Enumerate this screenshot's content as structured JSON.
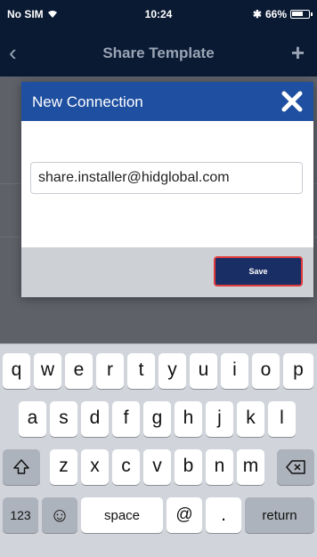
{
  "status_bar": {
    "carrier": "No SIM",
    "time": "10:24",
    "bluetooth": "✱",
    "battery": "66%"
  },
  "nav_bar": {
    "back_icon": "‹",
    "title": "Share Template",
    "add_icon": "+"
  },
  "dialog": {
    "title": "New Connection",
    "email_value": "share.installer@hidglobal.com",
    "save_label": "Save"
  },
  "keyboard": {
    "row1": [
      "q",
      "w",
      "e",
      "r",
      "t",
      "y",
      "u",
      "i",
      "o",
      "p"
    ],
    "row2": [
      "a",
      "s",
      "d",
      "f",
      "g",
      "h",
      "j",
      "k",
      "l"
    ],
    "row3": [
      "z",
      "x",
      "c",
      "v",
      "b",
      "n",
      "m"
    ],
    "numbers_label": "123",
    "emoji_icon": "☺",
    "space_label": "space",
    "at_label": "@",
    "period_label": ".",
    "return_label": "return"
  },
  "colors": {
    "dialog_header": "#1f4fa0",
    "save_button": "#1a2e66",
    "save_outline": "#e23b3b"
  }
}
